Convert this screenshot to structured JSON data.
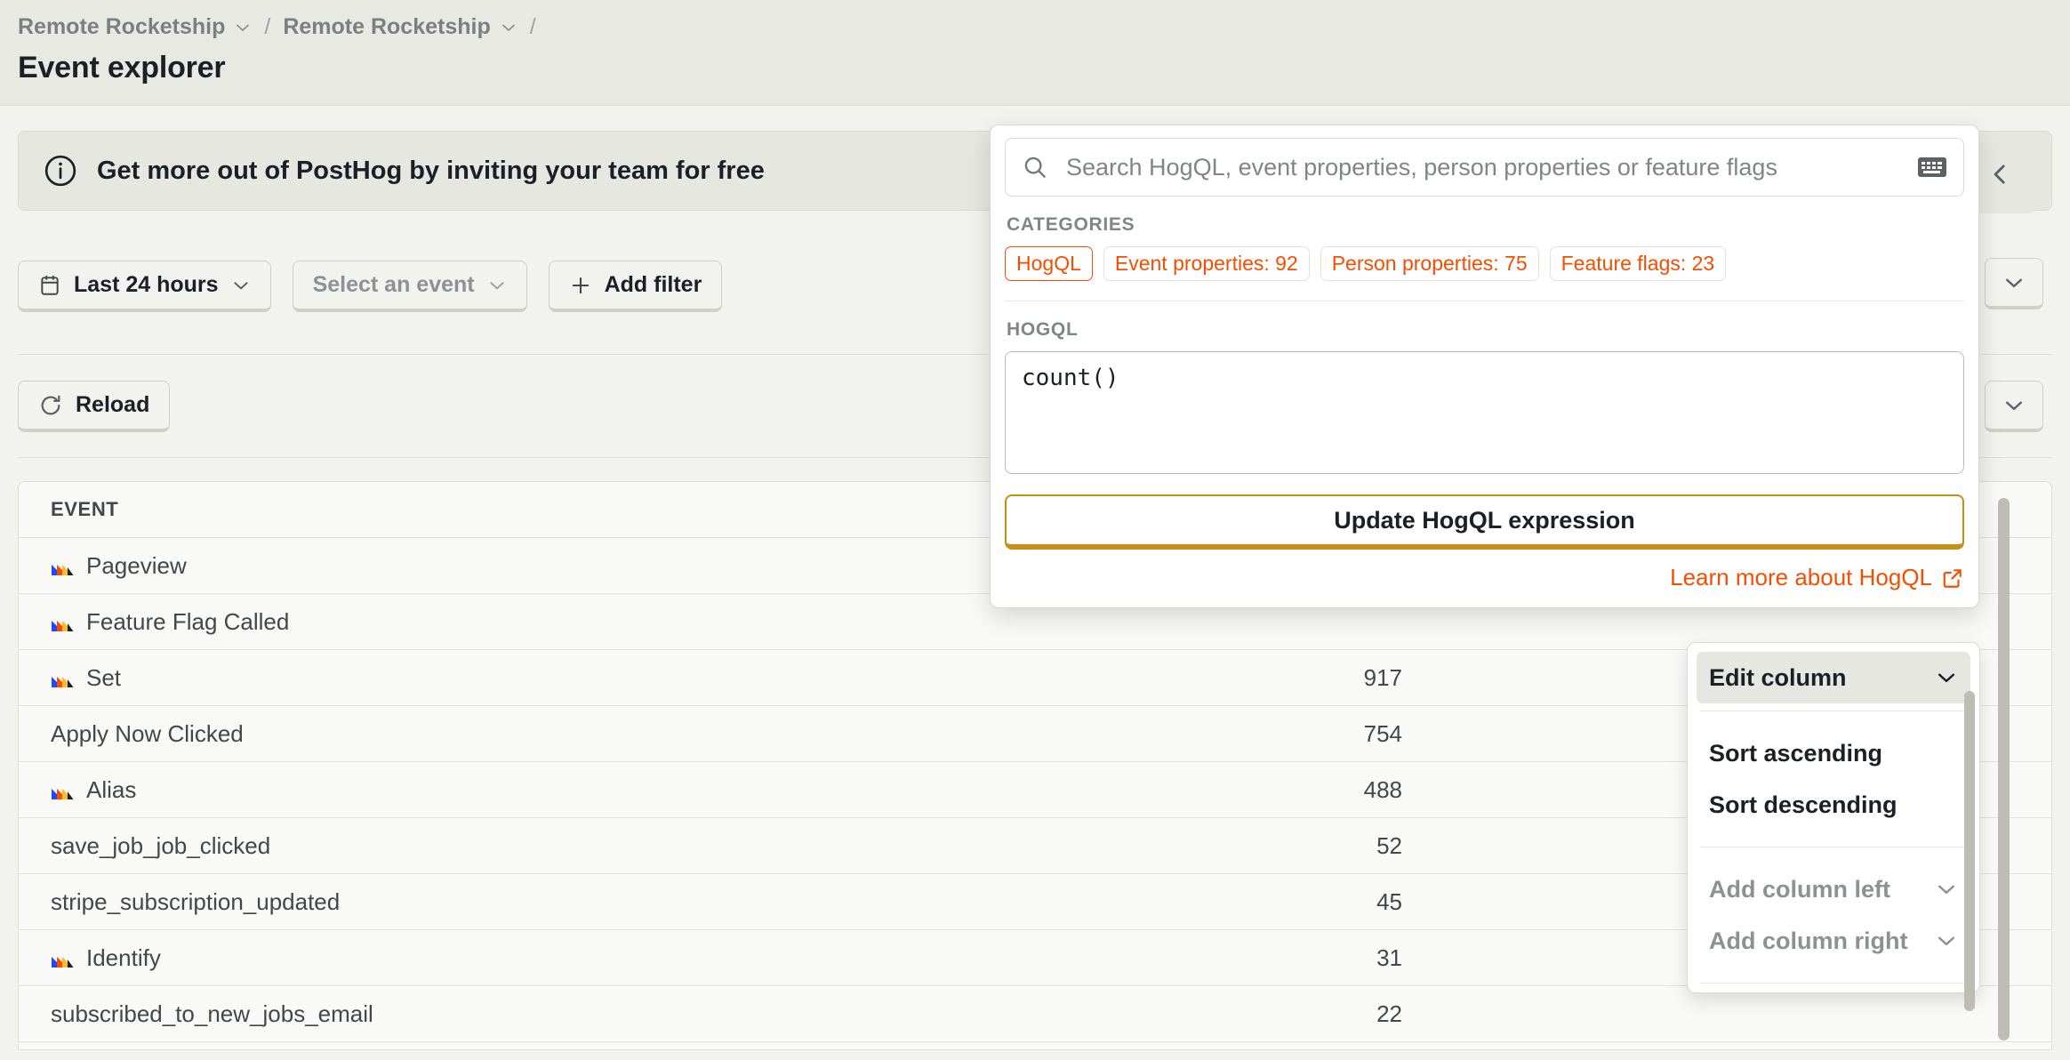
{
  "breadcrumb": {
    "items": [
      {
        "label": "Remote Rocketship",
        "has_chevron": true
      },
      {
        "label": "Remote Rocketship",
        "has_chevron": true
      }
    ],
    "separator": "/",
    "trailing_separator": "/"
  },
  "page": {
    "title": "Event explorer"
  },
  "banner": {
    "icon": "info-circle-icon",
    "text": "Get more out of PostHog by inviting your team for free"
  },
  "filters": {
    "date_range": {
      "label": "Last 24 hours",
      "icon": "calendar-icon"
    },
    "event_select": {
      "label": "Select an event",
      "icon": "chevron-down-icon"
    },
    "add_filter": {
      "label": "Add filter",
      "icon": "plus-icon"
    }
  },
  "toolbar": {
    "reload_label": "Reload",
    "reload_icon": "refresh-icon"
  },
  "table": {
    "columns": [
      "EVENT",
      ""
    ],
    "rows": [
      {
        "event": "Pageview",
        "has_posthog_icon": true,
        "count": ""
      },
      {
        "event": "Feature Flag Called",
        "has_posthog_icon": true,
        "count": ""
      },
      {
        "event": "Set",
        "has_posthog_icon": true,
        "count": "917"
      },
      {
        "event": "Apply Now Clicked",
        "has_posthog_icon": false,
        "count": "754"
      },
      {
        "event": "Alias",
        "has_posthog_icon": true,
        "count": "488"
      },
      {
        "event": "save_job_job_clicked",
        "has_posthog_icon": false,
        "count": "52"
      },
      {
        "event": "stripe_subscription_updated",
        "has_posthog_icon": false,
        "count": "45"
      },
      {
        "event": "Identify",
        "has_posthog_icon": true,
        "count": "31"
      },
      {
        "event": "subscribed_to_new_jobs_email",
        "has_posthog_icon": false,
        "count": "22"
      }
    ]
  },
  "popover": {
    "search": {
      "placeholder": "Search HogQL, event properties, person properties or feature flags",
      "value": "",
      "icon": "search-icon",
      "keyboard_icon": "keyboard-icon"
    },
    "categories_label": "CATEGORIES",
    "categories": [
      {
        "label": "HogQL",
        "active": true
      },
      {
        "label": "Event properties: 92",
        "active": false
      },
      {
        "label": "Person properties: 75",
        "active": false
      },
      {
        "label": "Feature flags: 23",
        "active": false
      }
    ],
    "hogql_label": "HOGQL",
    "hogql_expression": "count()",
    "update_button": "Update HogQL expression",
    "learn_more": "Learn more about HogQL",
    "learn_more_icon": "external-link-icon"
  },
  "column_menu": {
    "header": {
      "label": "Edit column",
      "icon": "chevron-down-icon"
    },
    "items": [
      {
        "label": "Sort ascending",
        "disabled": false,
        "icon": ""
      },
      {
        "label": "Sort descending",
        "disabled": false,
        "icon": ""
      },
      {
        "label": "Add column left",
        "disabled": true,
        "icon": "chevron-down-icon"
      },
      {
        "label": "Add column right",
        "disabled": true,
        "icon": "chevron-down-icon"
      }
    ]
  },
  "side_controls": {
    "collapse": {
      "icon": "chevron-left-icon"
    },
    "dropdown_1": {
      "icon": "chevron-down-icon"
    },
    "dropdown_2": {
      "icon": "chevron-down-icon"
    }
  },
  "colors": {
    "accent": "#f54e00",
    "warning_border": "#c98e19",
    "page_bg": "#f2f2ee",
    "header_bg": "#e9e9e4",
    "banner_bg": "#e5e7e0",
    "table_bg": "#f9f9f7",
    "border": "#dfdfd8",
    "text": "#1d1f27",
    "muted_text": "#8d9192"
  }
}
